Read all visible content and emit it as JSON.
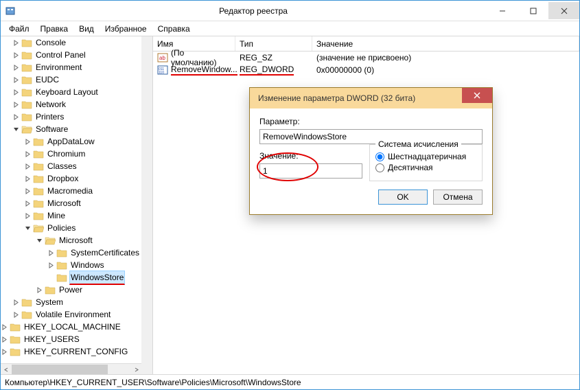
{
  "window": {
    "title": "Редактор реестра",
    "menus": [
      "Файл",
      "Правка",
      "Вид",
      "Избранное",
      "Справка"
    ]
  },
  "tree": {
    "top": [
      "Console",
      "Control Panel",
      "Environment",
      "EUDC",
      "Keyboard Layout",
      "Network",
      "Printers"
    ],
    "software": {
      "label": "Software",
      "children": [
        "AppDataLow",
        "Chromium",
        "Classes",
        "Dropbox",
        "Macromedia",
        "Microsoft",
        "Mine"
      ],
      "policies": {
        "label": "Policies",
        "microsoft": {
          "label": "Microsoft",
          "children": [
            "SystemCertificates",
            "Windows",
            "WindowsStore"
          ]
        },
        "after": [
          "Power"
        ]
      }
    },
    "bottom": [
      "System",
      "Volatile Environment"
    ],
    "hives": [
      "HKEY_LOCAL_MACHINE",
      "HKEY_USERS",
      "HKEY_CURRENT_CONFIG"
    ]
  },
  "list": {
    "cols": {
      "name": "Имя",
      "type": "Тип",
      "value": "Значение"
    },
    "rows": [
      {
        "name": "(По умолчанию)",
        "type": "REG_SZ",
        "value": "(значение не присвоено)",
        "icon": "string"
      },
      {
        "name": "RemoveWindow...",
        "type": "REG_DWORD",
        "value": "0x00000000 (0)",
        "icon": "binary"
      }
    ]
  },
  "dialog": {
    "title": "Изменение параметра DWORD (32 бита)",
    "param_label": "Параметр:",
    "param_value": "RemoveWindowsStore",
    "value_label": "Значение:",
    "value_value": "1",
    "radix_label": "Система исчисления",
    "radix_hex": "Шестнадцатеричная",
    "radix_dec": "Десятичная",
    "ok": "OK",
    "cancel": "Отмена"
  },
  "statusbar": "Компьютер\\HKEY_CURRENT_USER\\Software\\Policies\\Microsoft\\WindowsStore"
}
